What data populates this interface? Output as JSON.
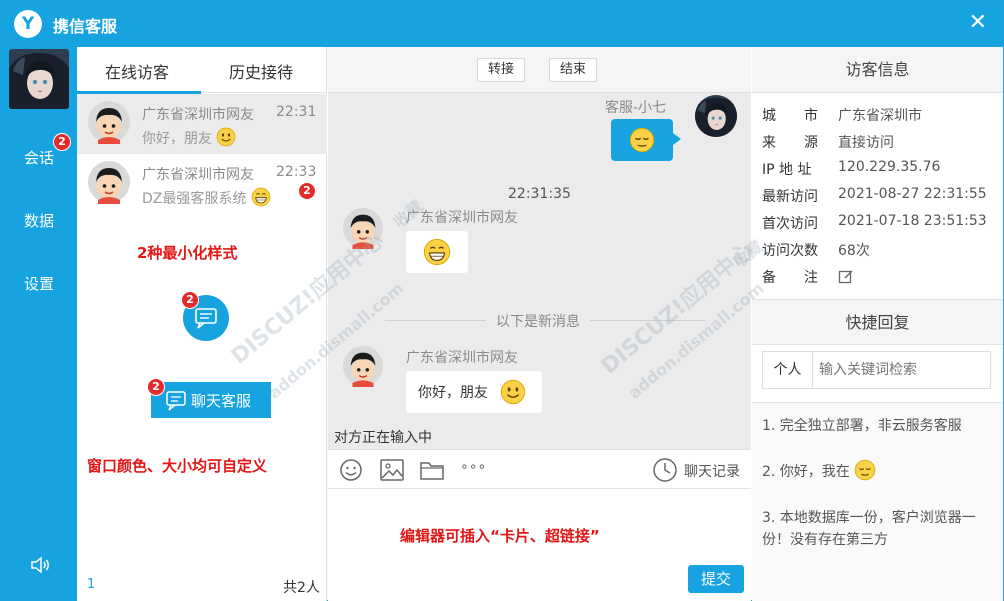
{
  "window": {
    "title": "携信客服",
    "logo_glyph": "Y",
    "close_glyph": "✕"
  },
  "rail": {
    "items": [
      {
        "label": "会话",
        "badge": "2"
      },
      {
        "label": "数据"
      },
      {
        "label": "设置"
      }
    ]
  },
  "list": {
    "tabs": [
      "在线访客",
      "历史接待"
    ],
    "visitors": [
      {
        "name": "广东省深圳市网友",
        "time": "22:31",
        "message": "你好，朋友"
      },
      {
        "name": "广东省深圳市网友",
        "time": "22:33",
        "message": "DZ最强客服系统",
        "badge": "2"
      }
    ],
    "note_minimize": "2种最小化样式",
    "mini_badge": "2",
    "mini_bar_label": "聊天客服",
    "mini_bar_badge": "2",
    "note_custom": "窗口颜色、大小均可自定义",
    "footer_page": "1",
    "footer_total": "共2人"
  },
  "chat": {
    "buttons": {
      "transfer": "转接",
      "end": "结束"
    },
    "agent_name": "客服-小七",
    "time_stamp": "22:31:35",
    "visitor_name_1": "广东省深圳市网友",
    "divider": "以下是新消息",
    "visitor_name_2": "广东省深圳市网友",
    "visitor_msg_2": "你好，朋友",
    "typing": "对方正在输入中",
    "history_label": "聊天记录",
    "editor_note": "编辑器可插入“卡片、超链接”",
    "submit": "提交",
    "more_glyph": "∘∘∘"
  },
  "info": {
    "header": "访客信息",
    "rows": [
      {
        "key": "城　　市",
        "value": "广东省深圳市"
      },
      {
        "key": "来　　源",
        "value": "直接访问"
      },
      {
        "key": "IP 地 址",
        "value": "120.229.35.76"
      },
      {
        "key": "最新访问",
        "value": "2021-08-27 22:31:55"
      },
      {
        "key": "首次访问",
        "value": "2021-07-18 23:51:53"
      },
      {
        "key": "访问次数",
        "value": "68次"
      },
      {
        "key": "备　　注",
        "value": ""
      }
    ],
    "quick_header": "快捷回复",
    "search_tag": "个人",
    "search_placeholder": "输入关键词检索",
    "replies": [
      "1. 完全独立部署，非云服务客服",
      "2. 你好，我在",
      "3. 本地数据库一份，客户浏览器一份！没有存在第三方"
    ]
  },
  "watermark": {
    "brand": "DISCUZ!应用中心",
    "domain": "addon.dismall.com",
    "tag": "收藏"
  },
  "colors": {
    "accent": "#16a3e0",
    "badge": "#e42b2b",
    "note": "#e41616"
  }
}
